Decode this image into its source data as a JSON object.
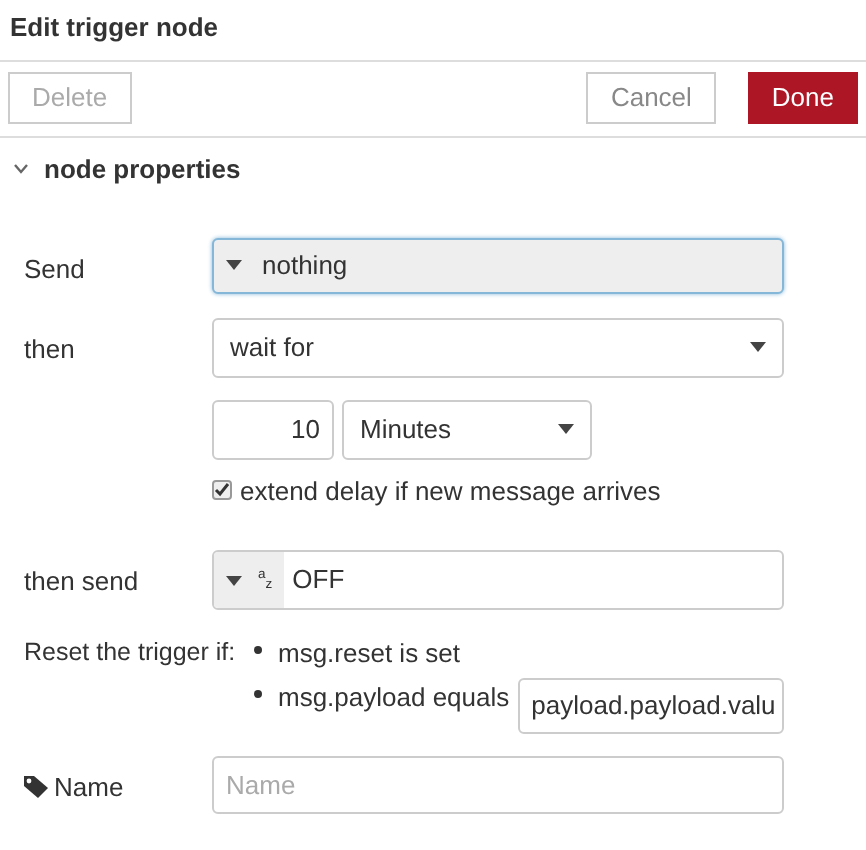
{
  "window": {
    "title": "Edit trigger node"
  },
  "toolbar": {
    "buttons": [
      {
        "label": "Delete",
        "kind": "plain",
        "disabled": true
      },
      {
        "label": "Cancel",
        "kind": "plain",
        "disabled": false
      },
      {
        "label": "Done",
        "kind": "primary",
        "disabled": false
      }
    ]
  },
  "section": {
    "title": "node properties",
    "expanded": true
  },
  "send": {
    "label": "Send",
    "value": "nothing"
  },
  "then": {
    "label": "then",
    "value": "wait for"
  },
  "delay": {
    "amount": "10",
    "unit": "Minutes"
  },
  "extend": {
    "label": "extend delay if new message arrives",
    "checked": true
  },
  "then_send": {
    "label": "then send",
    "type_label": "$^{a}$$_{z}$",
    "value": "OFF"
  },
  "reset": {
    "label": "Reset the trigger if:",
    "conditions": [
      {
        "text": "msg.reset is set"
      },
      {
        "text": "msg.payload equals",
        "value": "payload.payload.valu"
      }
    ]
  },
  "name": {
    "label": "Name",
    "placeholder": "Name"
  }
}
